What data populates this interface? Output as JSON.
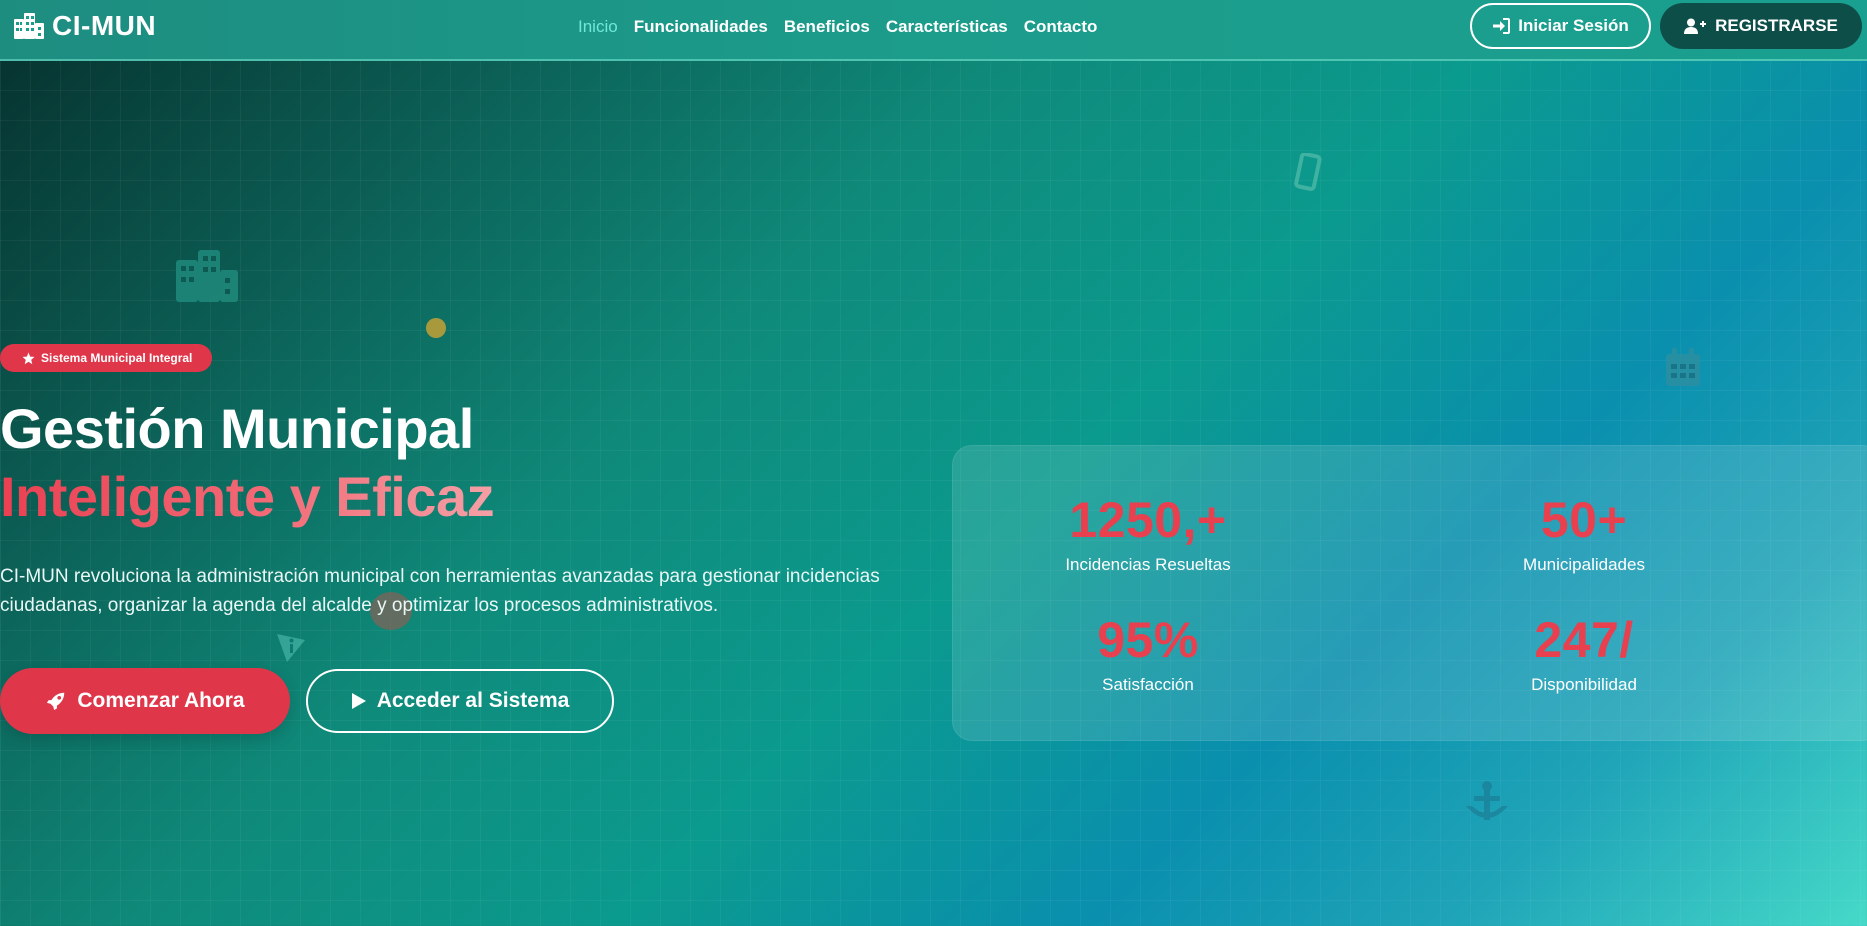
{
  "brand": {
    "name": "CI-MUN",
    "icon": "building-icon"
  },
  "nav": {
    "links": [
      {
        "label": "Inicio",
        "active": true
      },
      {
        "label": "Funcionalidades",
        "active": false
      },
      {
        "label": "Beneficios",
        "active": false
      },
      {
        "label": "Características",
        "active": false
      },
      {
        "label": "Contacto",
        "active": false
      }
    ],
    "login_label": "Iniciar Sesión",
    "register_label": "REGISTRARSE"
  },
  "hero": {
    "badge": "Sistema Municipal Integral",
    "title_line1": "Gestión Municipal",
    "title_line2": "Inteligente y Eficaz",
    "description": "CI-MUN revoluciona la administración municipal con herramientas avanzadas para gestionar incidencias ciudadanas, organizar la agenda del alcalde y optimizar los procesos administrativos.",
    "primary_button": "Comenzar Ahora",
    "secondary_button": "Acceder al Sistema"
  },
  "stats": [
    {
      "value": "1250,+",
      "label": "Incidencias Resueltas"
    },
    {
      "value": "50+",
      "label": "Municipalidades"
    },
    {
      "value": "95%",
      "label": "Satisfacción"
    },
    {
      "value": "247/",
      "label": "Disponibilidad"
    }
  ],
  "colors": {
    "accent_red": "#e0364a",
    "nav_teal": "#1c9c8b",
    "active_link": "#6fe8d6",
    "register_bg": "#0e4e48"
  },
  "decorations": [
    "building-icon",
    "mobile-icon",
    "calendar-icon",
    "dot-icon",
    "info-icon",
    "ball-icon",
    "anchor-icon"
  ]
}
